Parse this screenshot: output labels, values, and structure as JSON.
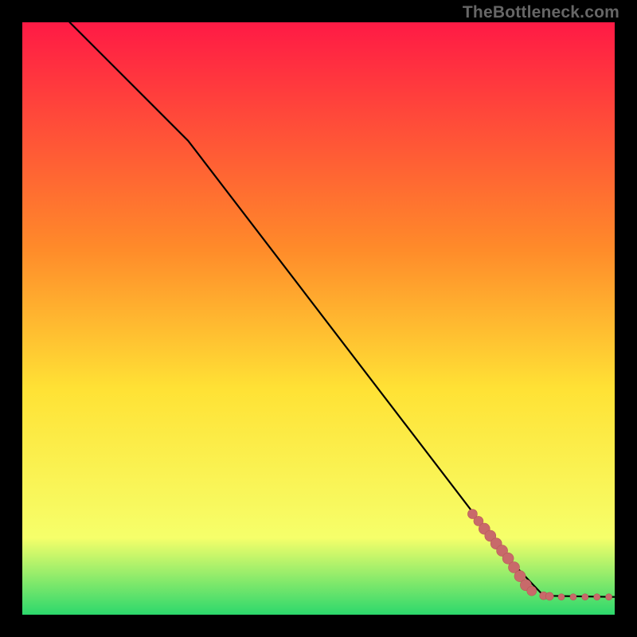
{
  "watermark": "TheBottleneck.com",
  "colors": {
    "frame": "#000000",
    "gradient_top": "#ff1a45",
    "gradient_mid1": "#ff8a2a",
    "gradient_mid2": "#ffe235",
    "gradient_mid3": "#f6ff6a",
    "gradient_bottom": "#2cd86c",
    "curve": "#000000",
    "marker_fill": "#c86a6a",
    "marker_stroke": "#b85858"
  },
  "chart_data": {
    "type": "line",
    "title": "",
    "xlabel": "",
    "ylabel": "",
    "xlim": [
      0,
      100
    ],
    "ylim": [
      0,
      100
    ],
    "series": [
      {
        "name": "curve",
        "x": [
          8,
          28,
          82,
          88,
          100
        ],
        "y": [
          100,
          80,
          9.5,
          3.2,
          3.0
        ]
      }
    ],
    "markers": {
      "name": "points",
      "x": [
        76,
        77,
        78,
        79,
        80,
        81,
        82,
        83,
        84,
        85,
        86,
        88,
        89,
        91,
        93,
        95,
        97,
        99
      ],
      "y": [
        17.0,
        15.8,
        14.5,
        13.3,
        12.0,
        10.8,
        9.5,
        8.0,
        6.5,
        5.0,
        4.0,
        3.2,
        3.1,
        3.0,
        3.0,
        3.0,
        3.0,
        3.0
      ],
      "r": [
        6,
        6,
        7,
        7,
        7,
        7,
        7,
        7,
        7,
        7,
        6,
        5,
        5,
        4,
        4,
        4,
        4,
        4
      ]
    }
  }
}
